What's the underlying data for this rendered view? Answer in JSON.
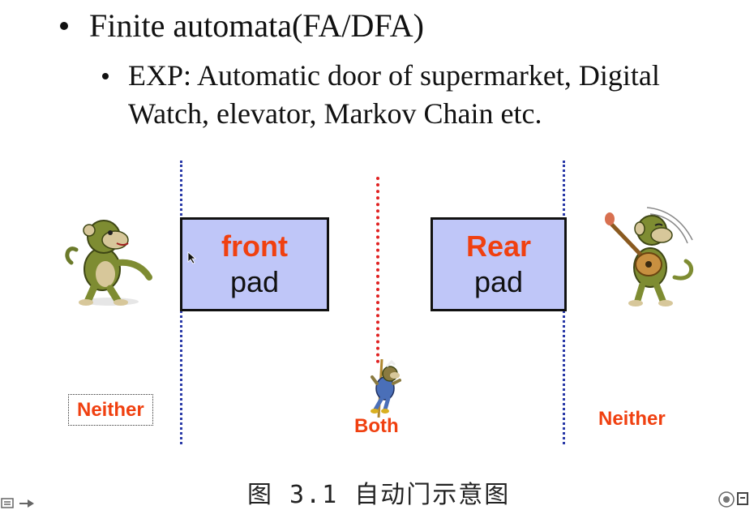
{
  "slide": {
    "bullet1": "Finite automata(FA/DFA)",
    "bullet2": "EXP: Automatic door of supermarket, Digital Watch, elevator, Markov Chain etc."
  },
  "diagram": {
    "front_pad": {
      "line1": "front",
      "line2": "pad"
    },
    "rear_pad": {
      "line1": "Rear",
      "line2": "pad"
    },
    "labels": {
      "left": "Neither",
      "center": "Both",
      "right": "Neither"
    },
    "caption": "图 3.1 自动门示意图",
    "colors": {
      "pad_fill": "#bfc6f8",
      "label": "#f04010",
      "blue_line": "#2a3aa8",
      "red_line": "#e02020"
    },
    "figures": [
      "monkey-walking",
      "monkey-climbing-pole",
      "monkey-guitar"
    ]
  }
}
